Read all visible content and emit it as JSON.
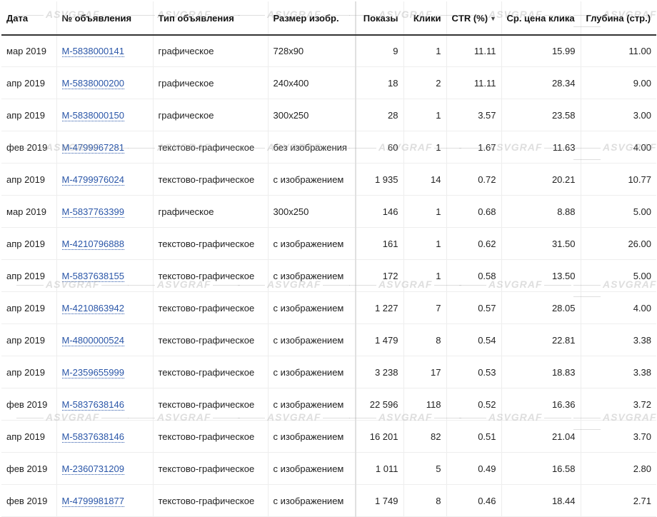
{
  "watermark": "ASVGRAF",
  "columns": {
    "date": "Дата",
    "ad_id": "№ объявления",
    "ad_type": "Тип объявления",
    "image_size": "Размер изобр.",
    "impressions": "Показы",
    "clicks": "Клики",
    "ctr": "CTR (%)",
    "avg_cpc": "Ср. цена клика",
    "depth": "Глубина (стр.)"
  },
  "rows": [
    {
      "date": "мар 2019",
      "ad_id": "M-5838000141",
      "ad_type": "графическое",
      "image_size": "728x90",
      "impressions": "9",
      "clicks": "1",
      "ctr": "11.11",
      "avg_cpc": "15.99",
      "depth": "11.00"
    },
    {
      "date": "апр 2019",
      "ad_id": "M-5838000200",
      "ad_type": "графическое",
      "image_size": "240x400",
      "impressions": "18",
      "clicks": "2",
      "ctr": "11.11",
      "avg_cpc": "28.34",
      "depth": "9.00"
    },
    {
      "date": "апр 2019",
      "ad_id": "M-5838000150",
      "ad_type": "графическое",
      "image_size": "300x250",
      "impressions": "28",
      "clicks": "1",
      "ctr": "3.57",
      "avg_cpc": "23.58",
      "depth": "3.00"
    },
    {
      "date": "фев 2019",
      "ad_id": "M-4799967281",
      "ad_type": "текстово-графическое",
      "image_size": "без изображения",
      "impressions": "60",
      "clicks": "1",
      "ctr": "1.67",
      "avg_cpc": "11.63",
      "depth": "4.00"
    },
    {
      "date": "апр 2019",
      "ad_id": "M-4799976024",
      "ad_type": "текстово-графическое",
      "image_size": "с изображением",
      "impressions": "1 935",
      "clicks": "14",
      "ctr": "0.72",
      "avg_cpc": "20.21",
      "depth": "10.77"
    },
    {
      "date": "мар 2019",
      "ad_id": "M-5837763399",
      "ad_type": "графическое",
      "image_size": "300x250",
      "impressions": "146",
      "clicks": "1",
      "ctr": "0.68",
      "avg_cpc": "8.88",
      "depth": "5.00"
    },
    {
      "date": "апр 2019",
      "ad_id": "M-4210796888",
      "ad_type": "текстово-графическое",
      "image_size": "с изображением",
      "impressions": "161",
      "clicks": "1",
      "ctr": "0.62",
      "avg_cpc": "31.50",
      "depth": "26.00"
    },
    {
      "date": "апр 2019",
      "ad_id": "M-5837638155",
      "ad_type": "текстово-графическое",
      "image_size": "с изображением",
      "impressions": "172",
      "clicks": "1",
      "ctr": "0.58",
      "avg_cpc": "13.50",
      "depth": "5.00"
    },
    {
      "date": "апр 2019",
      "ad_id": "M-4210863942",
      "ad_type": "текстово-графическое",
      "image_size": "с изображением",
      "impressions": "1 227",
      "clicks": "7",
      "ctr": "0.57",
      "avg_cpc": "28.05",
      "depth": "4.00"
    },
    {
      "date": "апр 2019",
      "ad_id": "M-4800000524",
      "ad_type": "текстово-графическое",
      "image_size": "с изображением",
      "impressions": "1 479",
      "clicks": "8",
      "ctr": "0.54",
      "avg_cpc": "22.81",
      "depth": "3.38"
    },
    {
      "date": "апр 2019",
      "ad_id": "M-2359655999",
      "ad_type": "текстово-графическое",
      "image_size": "с изображением",
      "impressions": "3 238",
      "clicks": "17",
      "ctr": "0.53",
      "avg_cpc": "18.83",
      "depth": "3.38"
    },
    {
      "date": "фев 2019",
      "ad_id": "M-5837638146",
      "ad_type": "текстово-графическое",
      "image_size": "с изображением",
      "impressions": "22 596",
      "clicks": "118",
      "ctr": "0.52",
      "avg_cpc": "16.36",
      "depth": "3.72"
    },
    {
      "date": "апр 2019",
      "ad_id": "M-5837638146",
      "ad_type": "текстово-графическое",
      "image_size": "с изображением",
      "impressions": "16 201",
      "clicks": "82",
      "ctr": "0.51",
      "avg_cpc": "21.04",
      "depth": "3.70"
    },
    {
      "date": "фев 2019",
      "ad_id": "M-2360731209",
      "ad_type": "текстово-графическое",
      "image_size": "с изображением",
      "impressions": "1 011",
      "clicks": "5",
      "ctr": "0.49",
      "avg_cpc": "16.58",
      "depth": "2.80"
    },
    {
      "date": "фев 2019",
      "ad_id": "M-4799981877",
      "ad_type": "текстово-графическое",
      "image_size": "с изображением",
      "impressions": "1 749",
      "clicks": "8",
      "ctr": "0.46",
      "avg_cpc": "18.44",
      "depth": "2.71"
    }
  ],
  "sort": {
    "column": "ctr",
    "direction": "desc",
    "icon": "sort-down-icon"
  },
  "colors": {
    "link": "#2a56a8",
    "header_border": "#333333",
    "row_border": "#eeeeee"
  }
}
